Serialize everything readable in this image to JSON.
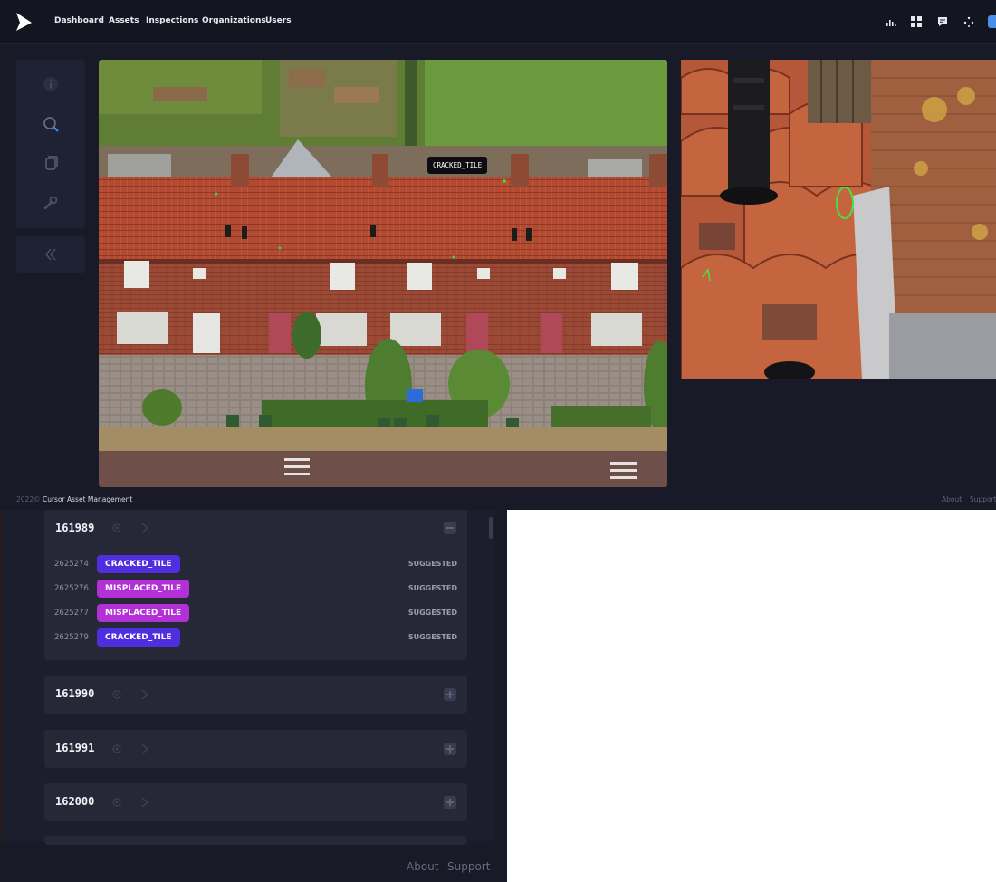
{
  "nav": {
    "links": [
      "Dashboard",
      "Assets",
      "Inspections",
      "Organizations",
      "Users"
    ]
  },
  "tools": [
    "info-icon",
    "search-icon",
    "copy-icon",
    "wrench-icon"
  ],
  "photo": {
    "annotation_label": "CRACKED_TILE"
  },
  "footer": {
    "year": "2022",
    "copyright_symbol": "©",
    "company": "Cursor Asset Management",
    "about": "About",
    "support": "Support"
  },
  "colors": {
    "cracked_tile": "#4f2ee0",
    "misplaced_tile": "#b32fd6",
    "background": "#181a27",
    "panel": "#262838"
  },
  "groups": [
    {
      "id": "161989",
      "expanded": true,
      "items": [
        {
          "id": "2625274",
          "tag": "CRACKED_TILE",
          "status": "SUGGESTED"
        },
        {
          "id": "2625276",
          "tag": "MISPLACED_TILE",
          "status": "SUGGESTED"
        },
        {
          "id": "2625277",
          "tag": "MISPLACED_TILE",
          "status": "SUGGESTED"
        },
        {
          "id": "2625279",
          "tag": "CRACKED_TILE",
          "status": "SUGGESTED"
        }
      ]
    },
    {
      "id": "161990",
      "expanded": false
    },
    {
      "id": "161991",
      "expanded": false
    },
    {
      "id": "162000",
      "expanded": false
    }
  ]
}
